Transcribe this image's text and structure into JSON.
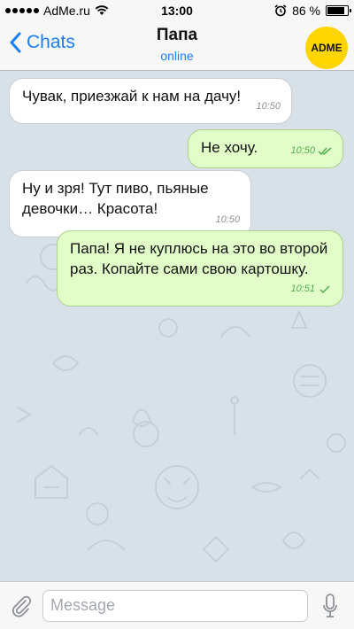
{
  "status_bar": {
    "carrier": "AdMe.ru",
    "time": "13:00",
    "battery": "86 %",
    "battery_level": 0.86,
    "icons": [
      "signal-dots-icon",
      "wifi-icon",
      "alarm-icon",
      "battery-icon"
    ]
  },
  "header": {
    "back_label": "Chats",
    "title": "Папа",
    "subtitle": "online",
    "avatar_text": "ADME"
  },
  "messages": [
    {
      "direction": "incoming",
      "text": "Чувак, приезжай к нам на дачу!",
      "time": "10:50",
      "status": ""
    },
    {
      "direction": "outgoing",
      "text": "Не хочу.",
      "time": "10:50",
      "status": "read"
    },
    {
      "direction": "incoming",
      "text": "Ну и зря! Тут пиво, пьяные девочки… Красота!",
      "time": "10:50",
      "status": ""
    },
    {
      "direction": "outgoing",
      "text": "Папа! Я не куплюсь на это во второй раз. Копайте сами свою картошку.",
      "time": "10:51",
      "status": "delivered"
    }
  ],
  "input": {
    "placeholder": "Message",
    "value": ""
  },
  "colors": {
    "accent": "#1a7ff2",
    "chat_background": "#d9e1e8",
    "incoming_bubble": "#ffffff",
    "outgoing_bubble": "#e2fec8",
    "checkmark": "#4fae4e",
    "avatar": "#ffd500"
  }
}
